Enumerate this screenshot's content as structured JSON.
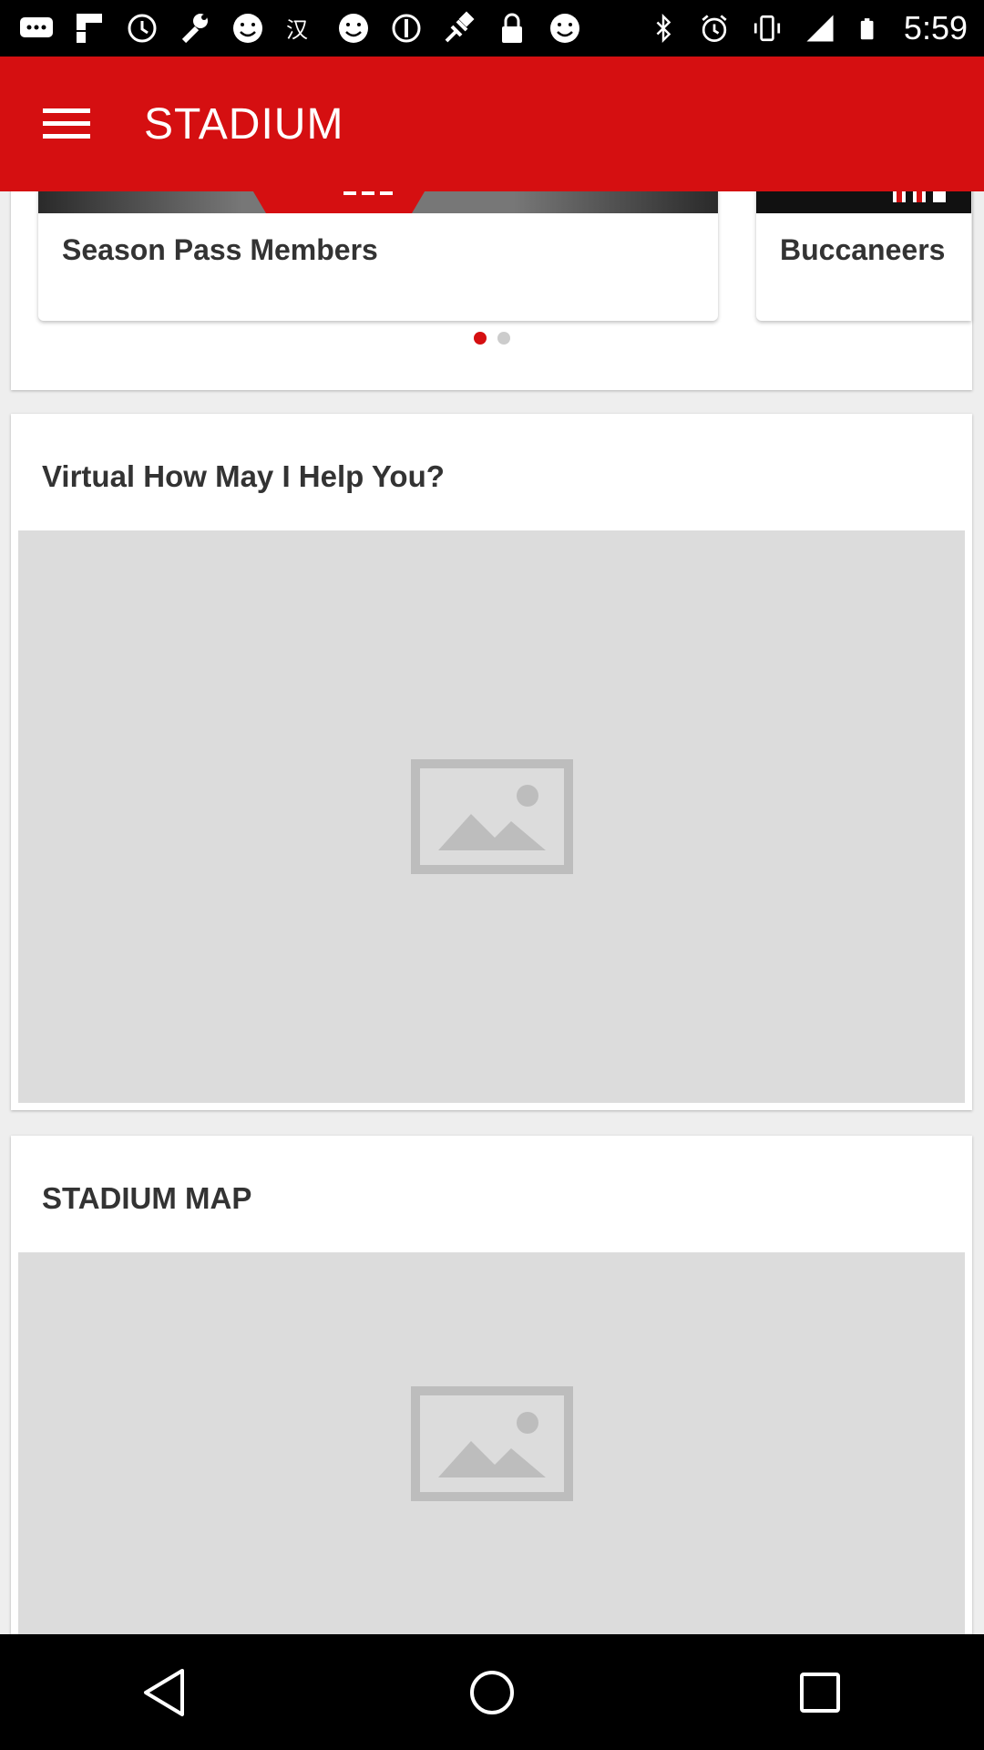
{
  "status_bar": {
    "time": "5:59",
    "icons": [
      "message-icon",
      "flipboard-icon",
      "clock-icon",
      "wrench-icon",
      "smiley-icon",
      "language-icon",
      "smiley-icon",
      "circle-icon",
      "fake-gps-icon",
      "lock-icon",
      "smiley-icon",
      "bluetooth-icon",
      "alarm-icon",
      "vibrate-icon",
      "signal-icon",
      "battery-icon"
    ]
  },
  "app_bar": {
    "title": "STADIUM",
    "menu_icon": "menu-icon",
    "color": "#d50f11"
  },
  "carousel": {
    "slides": [
      {
        "label": "Season Pass Members"
      },
      {
        "label": "Buccaneers"
      }
    ],
    "active_index": 0
  },
  "sections": [
    {
      "title": "Virtual How May I Help You?",
      "image_icon": "image-placeholder-icon"
    },
    {
      "title": "STADIUM MAP",
      "image_icon": "image-placeholder-icon"
    }
  ],
  "nav_bar": {
    "buttons": [
      "back-icon",
      "home-icon",
      "recents-icon"
    ]
  }
}
